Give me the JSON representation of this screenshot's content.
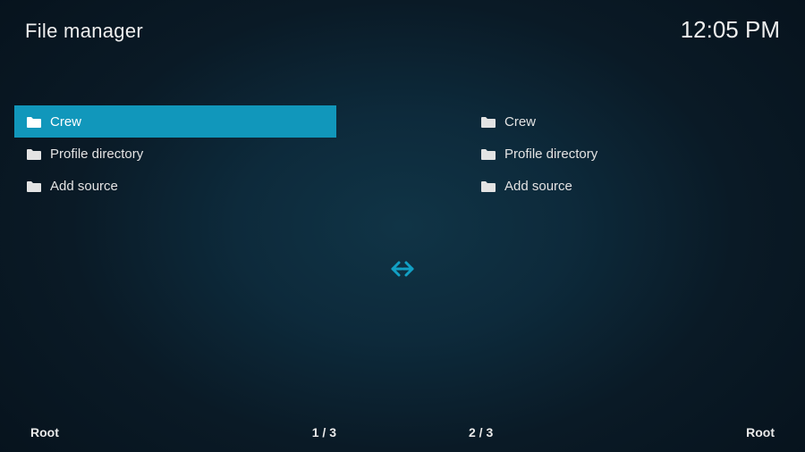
{
  "header": {
    "title": "File manager",
    "clock": "12:05 PM"
  },
  "panels": {
    "left": {
      "items": [
        {
          "label": "Crew",
          "selected": true
        },
        {
          "label": "Profile directory",
          "selected": false
        },
        {
          "label": "Add source",
          "selected": false
        }
      ],
      "path": "Root",
      "position": "1 / 3"
    },
    "right": {
      "items": [
        {
          "label": "Crew",
          "selected": false
        },
        {
          "label": "Profile directory",
          "selected": false
        },
        {
          "label": "Add source",
          "selected": false
        }
      ],
      "path": "Root",
      "position": "2 / 3"
    }
  },
  "colors": {
    "accent": "#1197bb",
    "icon": "#12a0c4"
  }
}
